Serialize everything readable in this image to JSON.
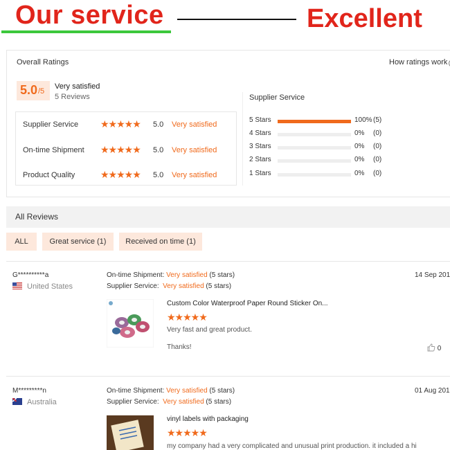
{
  "banner": {
    "title": "Our service",
    "word": "Excellent"
  },
  "ratings": {
    "title": "Overall Ratings",
    "how_link": "How ratings work",
    "score": "5.0",
    "score_max": "/5",
    "satisfaction": "Very satisfied",
    "reviews_count": "5 Reviews",
    "criteria": [
      {
        "label": "Supplier Service",
        "stars": "★★★★★",
        "score": "5.0",
        "satisfaction": "Very satisfied"
      },
      {
        "label": "On-time Shipment",
        "stars": "★★★★★",
        "score": "5.0",
        "satisfaction": "Very satisfied"
      },
      {
        "label": "Product Quality",
        "stars": "★★★★★",
        "score": "5.0",
        "satisfaction": "Very satisfied"
      }
    ],
    "distribution_title": "Supplier Service",
    "distribution": [
      {
        "label": "5 Stars",
        "fraction": 1.0,
        "pct": "100%",
        "count": "(5)"
      },
      {
        "label": "4 Stars",
        "fraction": 0,
        "pct": "0%",
        "count": "(0)"
      },
      {
        "label": "3 Stars",
        "fraction": 0,
        "pct": "0%",
        "count": "(0)"
      },
      {
        "label": "2 Stars",
        "fraction": 0,
        "pct": "0%",
        "count": "(0)"
      },
      {
        "label": "1 Stars",
        "fraction": 0,
        "pct": "0%",
        "count": "(0)"
      }
    ],
    "accent_color": "#f06a1c"
  },
  "reviews_section": {
    "title": "All Reviews",
    "filters": [
      "ALL",
      "Great service (1)",
      "Received on time (1)"
    ]
  },
  "reviews": [
    {
      "user": "G**********a",
      "country": "United States",
      "flag": "us-flag-icon",
      "shipment_label": "On-time Shipment:",
      "shipment_value": "Very satisfied",
      "shipment_stars": "(5 stars)",
      "service_label": "Supplier Service:",
      "service_value": "Very satisfied",
      "service_stars": "(5 stars)",
      "date": "14 Sep 201",
      "product": "Custom Color Waterproof Paper Round Sticker On...",
      "stars": "★★★★★",
      "text1": "Very fast and great product.",
      "text2": "Thanks!",
      "likes": "0"
    },
    {
      "user": "M*********n",
      "country": "Australia",
      "flag": "au-flag-icon",
      "shipment_label": "On-time Shipment:",
      "shipment_value": "Very satisfied",
      "shipment_stars": "(5 stars)",
      "service_label": "Supplier Service:",
      "service_value": "Very satisfied",
      "service_stars": "(5 stars)",
      "date": "01 Aug 201",
      "product": "vinyl labels with packaging",
      "stars": "★★★★★",
      "text1": "my company had a very complicated and unusual print production. it included a hi"
    }
  ]
}
